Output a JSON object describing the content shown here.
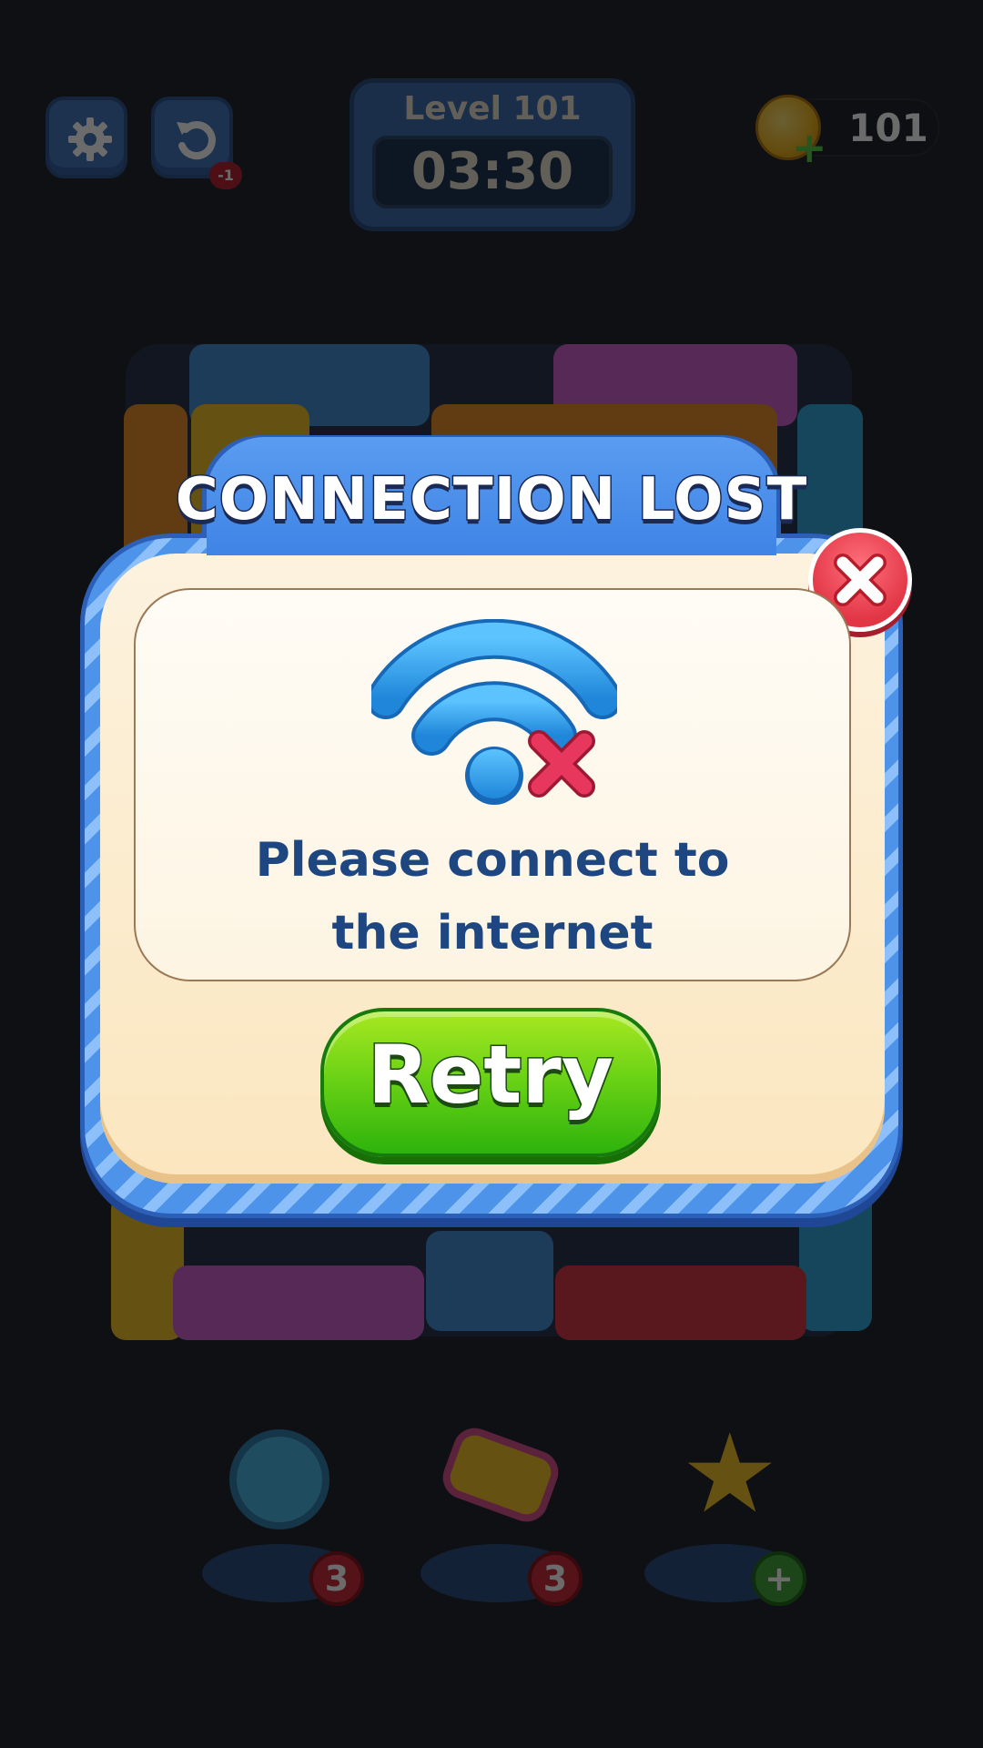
{
  "hud": {
    "settings_icon": "gear-icon",
    "undo_icon": "undo-icon",
    "undo_cost": "-1",
    "level_label": "Level 101",
    "timer": "03:30",
    "coins": "101",
    "coin_icon": "coin-star-icon",
    "add_coins_icon": "plus-icon"
  },
  "board": {
    "colors": {
      "blue": "#3b8fe0",
      "purple": "#d65fd6",
      "orange": "#f08a1c",
      "yellow": "#f7c21b",
      "red": "#e23646",
      "cyan": "#2aa9e3",
      "slot": "#2b3550"
    }
  },
  "boosters": [
    {
      "name": "clock",
      "icon": "alarm-clock-icon",
      "count": "3"
    },
    {
      "name": "hammer",
      "icon": "hammer-icon",
      "count": "3"
    },
    {
      "name": "star-wand",
      "icon": "star-wand-icon",
      "count": "+"
    }
  ],
  "dialog": {
    "title": "CONNECTION LOST",
    "icon": "wifi-off-icon",
    "message_line1": "Please connect to",
    "message_line2": "the internet",
    "retry_label": "Retry",
    "close_icon": "close-icon",
    "colors": {
      "frame": "#4a8fea",
      "cream": "#fcefd6",
      "text": "#1e4680",
      "retry": "#5cc914",
      "close": "#e23646"
    }
  }
}
